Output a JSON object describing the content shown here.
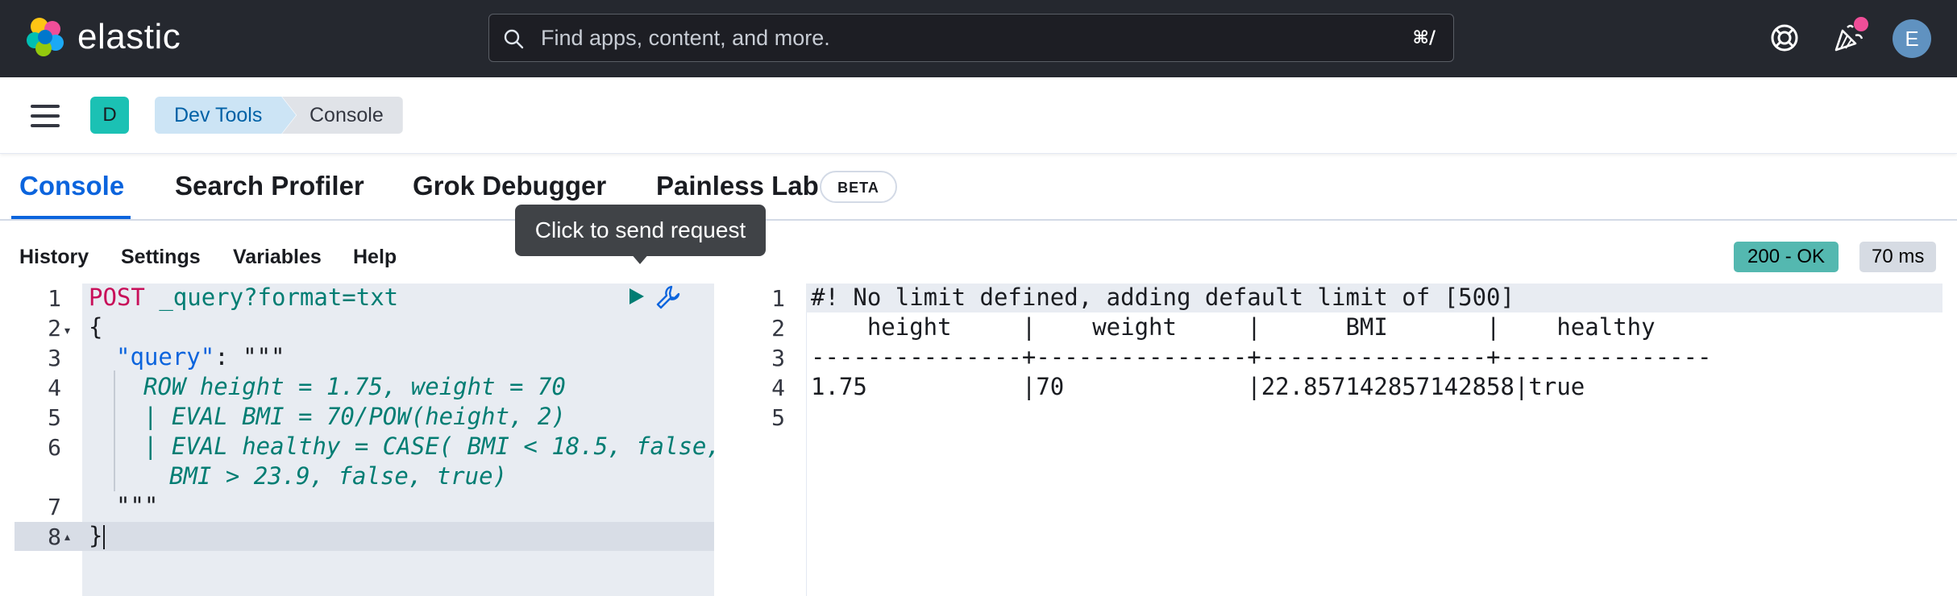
{
  "header": {
    "brand": "elastic",
    "search_placeholder": "Find apps, content, and more.",
    "search_shortcut": "⌘/",
    "avatar_initial": "E"
  },
  "breadcrumbs": {
    "space_initial": "D",
    "items": [
      "Dev Tools",
      "Console"
    ]
  },
  "tabs": {
    "items": [
      "Console",
      "Search Profiler",
      "Grok Debugger",
      "Painless Lab"
    ],
    "active": "Console",
    "beta_badge": "BETA"
  },
  "toolbar": {
    "items": [
      "History",
      "Settings",
      "Variables",
      "Help"
    ],
    "status": "200 - OK",
    "duration": "70 ms"
  },
  "tooltip": "Click to send request",
  "request_editor": {
    "line_numbers": [
      "1",
      "2",
      "3",
      "4",
      "5",
      "6",
      "7",
      "8"
    ],
    "method": "POST",
    "path": "_query?format=txt",
    "lines": {
      "l2": "{",
      "l3_key": "\"query\"",
      "l3_rest": ": \"\"\"",
      "l4": "ROW height = 1.75, weight = 70",
      "l5": "| EVAL BMI = 70/POW(height, 2)",
      "l6a": "| EVAL healthy = CASE( BMI < 18.5, false,",
      "l6b": "BMI > 23.9, false, true)",
      "l7": "\"\"\"",
      "l8": "}"
    }
  },
  "response_editor": {
    "line_numbers": [
      "1",
      "2",
      "3",
      "4",
      "5"
    ],
    "lines": [
      "#! No limit defined, adding default limit of [500]",
      "    height     |    weight     |      BMI       |    healthy",
      "---------------+---------------+----------------+---------------",
      "1.75           |70             |22.857142857142858|true",
      ""
    ]
  },
  "colors": {
    "header_bg": "#25282f",
    "accent": "#0b64dd",
    "status_ok": "#54b8b0",
    "string_green": "#017d73",
    "keyword": "#c8105a"
  }
}
